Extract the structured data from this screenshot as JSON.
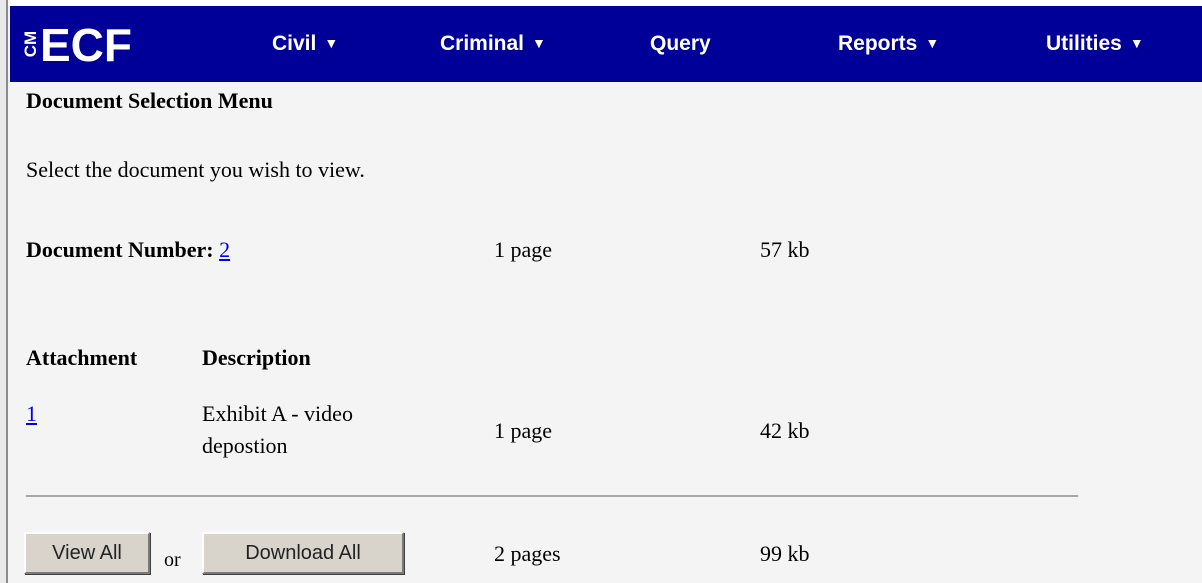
{
  "app": {
    "logo_text": "CM ECF"
  },
  "nav": {
    "items": [
      {
        "label": "Civil",
        "has_menu": true
      },
      {
        "label": "Criminal",
        "has_menu": true
      },
      {
        "label": "Query",
        "has_menu": false
      },
      {
        "label": "Reports",
        "has_menu": true
      },
      {
        "label": "Utilities",
        "has_menu": true
      }
    ],
    "caret": "▼"
  },
  "page": {
    "title": "Document Selection Menu",
    "instruction": "Select the document you wish to view."
  },
  "document": {
    "label": "Document Number:",
    "number": "2",
    "pages": "1 page",
    "size": "57 kb"
  },
  "attachments": {
    "headers": [
      "Attachment",
      "Description"
    ],
    "rows": [
      {
        "number": "1",
        "description": "Exhibit A - video depostion",
        "pages": "1 page",
        "size": "42 kb"
      }
    ]
  },
  "actions": {
    "view_all_label": "View All",
    "or_text": "or",
    "download_all_label": "Download All",
    "total_pages": "2 pages",
    "total_size": "99 kb"
  },
  "colors": {
    "navbar": "#000099",
    "link": "#0000ee",
    "background": "#f4f4f4"
  }
}
